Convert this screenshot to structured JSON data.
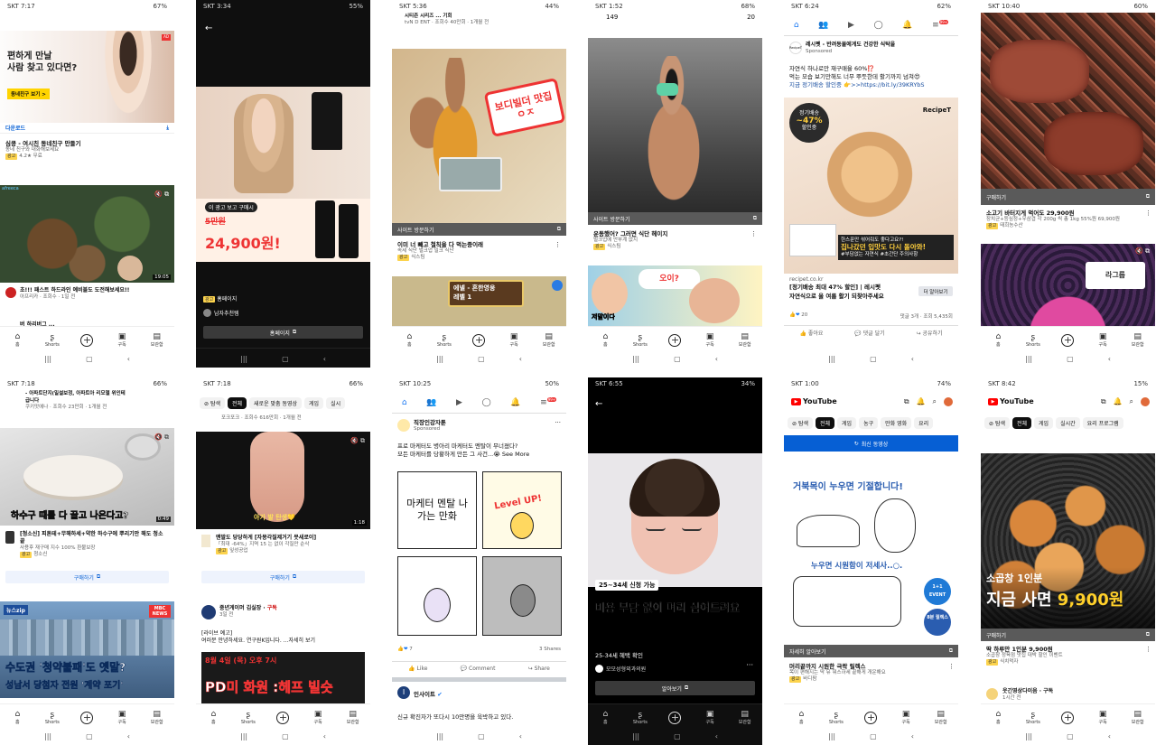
{
  "nav": {
    "home": "홈",
    "shorts": "Shorts",
    "subs": "구독",
    "lib": "보관함"
  },
  "s1": {
    "status": "SKT 7:17",
    "batt": "67%",
    "adline1": "편하게 만날",
    "adline2": "사람 찾고 있다면?",
    "adbtn": "동네친구 보기 >",
    "download": "다운로드",
    "title": "심쿵 - 여시친 동네친구 만들기",
    "sub": "동네 친구와 대화해보세요",
    "rating": "4.2★ 무료",
    "afreeca": "afreeca",
    "dur": "19:05",
    "vtitle": "초!!! 패스트 하드라인 예비블도 도전해보세요!!",
    "vsub": "아프리카 · 조회수 · 1일 전",
    "next": "버 하리버그 ..."
  },
  "s2": {
    "status": "SKT 3:34",
    "batt": "55%",
    "banner1": "이 광고 보고 구매시",
    "banner2": "5만원",
    "price": "24,900원!",
    "ad": "광고",
    "homepage": "홈페이지",
    "channel": "남자추천템",
    "btn": "홈페이지"
  },
  "s3": {
    "status": "SKT 5:36",
    "batt": "44%",
    "top1": "시티즌 시리즈 ... 기회",
    "top2": "tvN D ENT · 조회수 40만회 · 1개월 전",
    "stamp": "보디빌더 맛집ㅇㅈ",
    "visit": "사이트 방문하기",
    "title": "이미 너 빼고 철칙을 다 먹는중이래",
    "sub": "속세 식단 벌크업 밀크 식단",
    "brand": "식스팀",
    "game1": "에넬 - 흔한영웅",
    "game2": "레벨 1"
  },
  "s4": {
    "status": "SKT 1:52",
    "batt": "68%",
    "top1": "149",
    "top2": "20",
    "visit": "사이트 방문하기",
    "title": "운동했어? 그러면 식단 헤이지",
    "sub": "벌크업에 안부계 없지",
    "brand": "식스팀",
    "bubble": "오이?",
    "bottom": "저말이다"
  },
  "s5": {
    "status": "SKT 6:24",
    "batt": "62%",
    "badge": "99+",
    "brand": "레시펫 - 반려동물에게도 건강한 식탁을",
    "sponsored": "Sponsored",
    "text1": "자연식 하나로만 재구매율 60%⁉️",
    "text2": "먹는 모습 보기만해도 너무 뿌듯한데 활기까지 넘쳐😍",
    "text3": "지금 정기배송 할인중 👉>>https://bit.ly/39KRYbS",
    "disc1": "정기배송",
    "disc2": "~47%",
    "disc3": "할인중",
    "logo": "RecipeT",
    "cap1": "한스푼만 섞어줘도 좋다고요?!",
    "cap2": "집나갔던 입맛도 다시 돌아와!",
    "cap3": "#부담없는 자연식 #초간단 주의사항",
    "url": "recipet.co.kr",
    "head": "[정기배송 최대 47% 할인] | 레시펫",
    "desc": "자연식으로 올 여름 활기 되찾아주세요",
    "more": "더 알아보기",
    "count": "20",
    "comments": "댓글 3개 · 조회 5,435회",
    "like": "좋아요",
    "comment": "댓글 달기",
    "share": "공유하기"
  },
  "s6": {
    "status": "SKT 10:40",
    "batt": "60%",
    "buy": "구매하기",
    "title": "소고기 바터지게 먹어도 29,900원",
    "sub": "장치균+등심정+우삼겹 각 200g 씩 총 1kg 55%원 69,900원",
    "brand": "태희농수산",
    "show": "라그룹"
  },
  "s7": {
    "status": "SKT 7:18",
    "batt": "66%",
    "top1": "- 아파트단지(밀설보정, 아파트아 리모델 위인테",
    "top2": "급니다",
    "top3": "쿠키맛에나 · 조회수 23만회 · 1개월 전",
    "over": "하수구 때를 다 끌고 나온다고?",
    "dur": "0:49",
    "title": "[청소신] 피톤테+무해하세+약한 하수구에 뿌리기만 해도 청소 끝",
    "sub": "사용후 재구매 지수 100% 환불보장",
    "brand": "청소신",
    "buy": "구매하기",
    "news": "뉴스zip",
    "mbc": "MBC NEWS",
    "h1": "수도권 '청약불패'도 옛말?",
    "h2": "성남서 당첨자 전원 '계약 포기'"
  },
  "s8": {
    "status": "SKT 7:18",
    "batt": "66%",
    "chips": [
      "탐색",
      "전체",
      "새로운 맞춤 동영상",
      "게임",
      "실시"
    ],
    "top": "포크포크 · 조회수 616만회 · 1개월 전",
    "cap": "아가 발 탄생💛",
    "dur": "1:18",
    "title": "맨발도 당당하게 [자몽각질제거기 뭇새로이]",
    "sub": "「최대 -64%」지역 15 는 없이 각질만 순삭",
    "brand": "잎성공업",
    "buy": "구매하기",
    "ch": "중년게이머 김실장",
    "chsub": "3일 전",
    "t2a": "[라이브 예고]",
    "t2b": "여러분 안녕하세요. 연구원K입니다. ...자세히 보기",
    "date": "8월 4일 (목) 오후 7시",
    "bigtxt": "PD미 화원 :헤프 빌슷"
  },
  "s9": {
    "status": "SKT 10:25",
    "batt": "50%",
    "badge": "99+",
    "brand": "직장인강자툰",
    "sponsored": "Sponsored",
    "text1": "프로 마케터도 병아리 마케터도 멘탈이 무너졌다?",
    "text2": "모든 마케터를 당황하게 만든 그 사건...😭 See More",
    "c1": "마케터 멘탈 나가는 만화",
    "c2": "Level UP!",
    "count": "7",
    "shares": "3 Shares",
    "like": "Like",
    "comment": "Comment",
    "share": "Share",
    "brand2": "인사이트",
    "text3": "신규 확진자가 또다시 10만명을 육박하고 있다."
  },
  "s10": {
    "status": "SKT 6:55",
    "batt": "34%",
    "tag": "25~34세 신청 가능",
    "big": "비용 부담 없이 머리 심어드려요",
    "t1": "25-34세 혜택 확인",
    "t2": "모모성형외과의원",
    "btn": "알아보기"
  },
  "s11": {
    "status": "SKT 1:00",
    "batt": "74%",
    "yt": "YouTube",
    "chips": [
      "탐색",
      "전체",
      "게임",
      "농구",
      "만화 영화",
      "요리"
    ],
    "latest": "최신 동영상",
    "h1": "거북목이 누우면 기절합니다!",
    "h2": "누우면 시원함이 저세사..○.",
    "event": "1+1 EVENT",
    "event2": "8분 릴렉스",
    "more": "자세히 알아보기",
    "title": "머리끝까지 시원한 극락 릴렉스",
    "sub": "목이 편해지는 딱 뮤 뭐스하세 끝해게 개운해요",
    "brand": "바디팜"
  },
  "s12": {
    "status": "SKT 8:42",
    "batt": "15%",
    "yt": "YouTube",
    "chips": [
      "탐색",
      "전체",
      "게임",
      "실시간",
      "요리 프로그램"
    ],
    "t1": "소곱창 1인분",
    "t2": "지금 사면",
    "price": "9,900원",
    "buy": "구매하기",
    "title": "딱 하루만 1인분 9,900원",
    "sub": "소곱창 정육점 맛집 대박 할인 이벤트",
    "brand": "식치먹자",
    "ch": "웃긴영상다이음 · 구독",
    "chsub": "1시간 전"
  }
}
